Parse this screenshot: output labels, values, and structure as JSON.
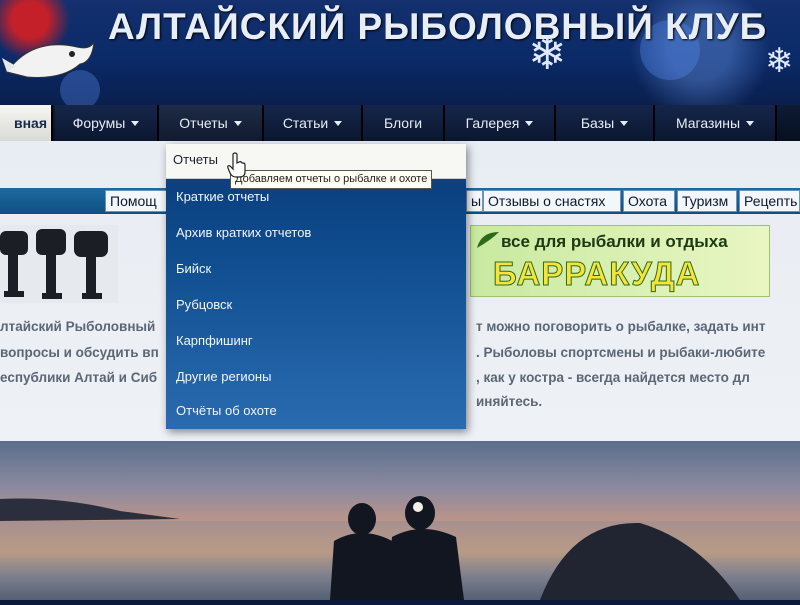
{
  "header": {
    "title": "АЛТАЙСКИЙ РЫБОЛОВНЫЙ КЛУБ"
  },
  "nav": {
    "items": [
      {
        "label": "вная",
        "has_caret": false
      },
      {
        "label": "Форумы",
        "has_caret": true
      },
      {
        "label": "Отчеты",
        "has_caret": true
      },
      {
        "label": "Статьи",
        "has_caret": true
      },
      {
        "label": "Блоги",
        "has_caret": false
      },
      {
        "label": "Галерея",
        "has_caret": true
      },
      {
        "label": "Базы",
        "has_caret": true
      },
      {
        "label": "Магазины",
        "has_caret": true
      }
    ]
  },
  "subnav": {
    "items": [
      "Помощ",
      "ы",
      "Отзывы о снастях",
      "Охота",
      "Туризм",
      "Рецепть"
    ]
  },
  "banner": {
    "tagline": "все для рыбалки и отдыха",
    "brand": "БАРРАКУДА"
  },
  "intro": {
    "lines": [
      {
        "left": "лтайский Рыболовный",
        "right": "т можно поговорить о рыбалке, задать инт"
      },
      {
        "left": "вопросы и обсудить вп",
        "right": ". Рыболовы спортсмены и рыбаки-любите"
      },
      {
        "left": "еспублики Алтай и Сиб",
        "right": ", как у костра - всегда найдется место дл"
      },
      {
        "left": "",
        "right": "иняйтесь."
      }
    ]
  },
  "dropdown": {
    "first_item": "Отчеты",
    "tooltip": "Добавляем отчеты о рыбалке и охоте",
    "items": [
      "Краткие отчеты",
      "Архив кратких отчетов",
      "Бийск",
      "Рубцовск",
      "Карпфишинг",
      "Другие регионы",
      "Отчёты об охоте"
    ]
  },
  "colors": {
    "header_bg": "#0b2a68",
    "nav_bg": "#0b1730",
    "dropdown_bg": "#0f4d8f",
    "subnav_bg": "#1e6aa0",
    "banner_brand": "#f7e43a"
  }
}
